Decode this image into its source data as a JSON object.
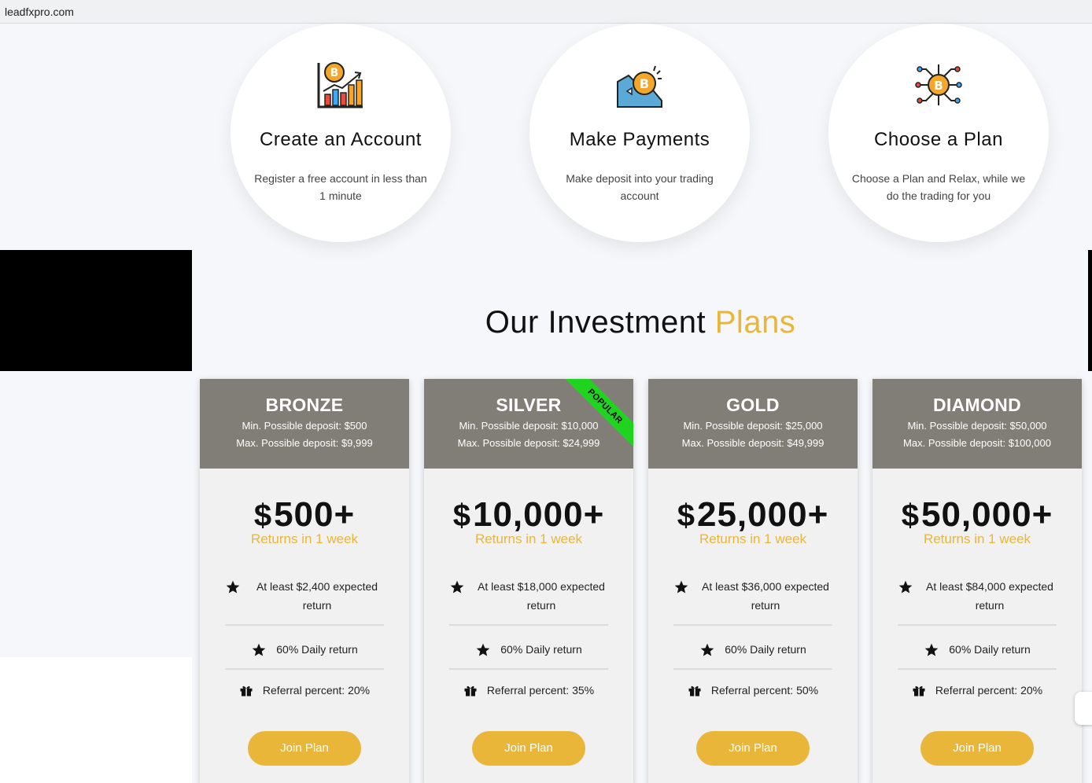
{
  "browser": {
    "url": "leadfxpro.com"
  },
  "steps": [
    {
      "title": "Create an Account",
      "desc": "Register a free account in less than 1 minute",
      "icon": "bitcoin-chart-icon"
    },
    {
      "title": "Make Payments",
      "desc": "Make deposit into your trading account",
      "icon": "bitcoin-payment-icon"
    },
    {
      "title": "Choose a Plan",
      "desc": "Choose a Plan and Relax, while we do the trading for you",
      "icon": "bitcoin-network-icon"
    }
  ],
  "section": {
    "heading_main": "Our Investment ",
    "heading_accent": "Plans"
  },
  "plans": [
    {
      "name": "BRONZE",
      "min": "Min. Possible deposit: $500",
      "max": "Max. Possible deposit: $9,999",
      "currency": "$",
      "price": "500+",
      "returns": "Returns in 1 week",
      "feature1": "At least $2,400 expected return",
      "feature2": "60% Daily return",
      "feature3": "Referral percent: 20%",
      "button": "Join Plan"
    },
    {
      "name": "SILVER",
      "min": "Min. Possible deposit: $10,000",
      "max": "Max. Possible deposit: $24,999",
      "currency": "$",
      "price": "10,000+",
      "returns": "Returns in 1 week",
      "feature1": "At least $18,000 expected return",
      "feature2": "60% Daily return",
      "feature3": "Referral percent: 35%",
      "button": "Join Plan",
      "ribbon": "POPULAR"
    },
    {
      "name": "GOLD",
      "min": "Min. Possible deposit: $25,000",
      "max": "Max. Possible deposit: $49,999",
      "currency": "$",
      "price": "25,000+",
      "returns": "Returns in 1 week",
      "feature1": "At least $36,000 expected return",
      "feature2": "60% Daily return",
      "feature3": "Referral percent: 50%",
      "button": "Join Plan"
    },
    {
      "name": "DIAMOND",
      "min": "Min. Possible deposit: $50,000",
      "max": "Max. Possible deposit: $100,000",
      "currency": "$",
      "price": "50,000+",
      "returns": "Returns in 1 week",
      "feature1": "At least $84,000 expected return",
      "feature2": "60% Daily return",
      "feature3": "Referral percent: 20%",
      "button": "Join Plan"
    }
  ],
  "colors": {
    "accent": "#e9b63a",
    "card_header": "#817e77",
    "ribbon": "#1ed41e"
  }
}
